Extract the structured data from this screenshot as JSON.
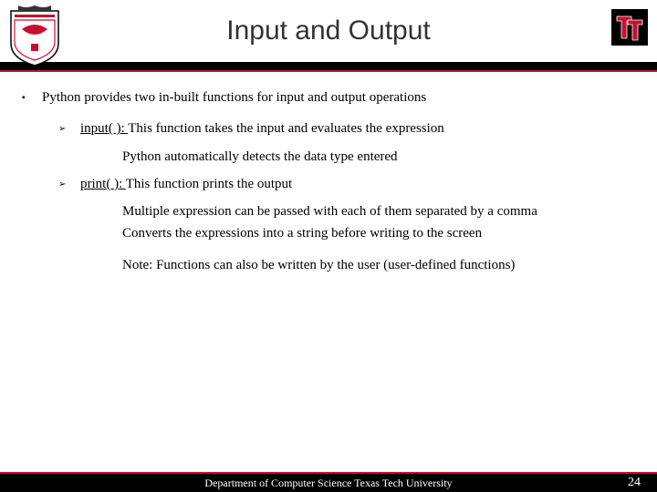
{
  "title": "Input and Output",
  "main_bullet": "Python provides two in-built functions for input and output operations",
  "item1_func": "input( ): ",
  "item1_desc": "This function takes the input and evaluates the expression",
  "item1_sub": "Python automatically detects the data type entered",
  "item2_func": "print( ): ",
  "item2_desc": "This function prints the output",
  "item2_sub1": "Multiple expression can be passed with each of them separated by a comma",
  "item2_sub2": "Converts the expressions into a string before writing to the screen",
  "note": "Note: Functions can also be written by the user (user-defined functions)",
  "footer": "Department of Computer Science Texas Tech University",
  "page": "24"
}
